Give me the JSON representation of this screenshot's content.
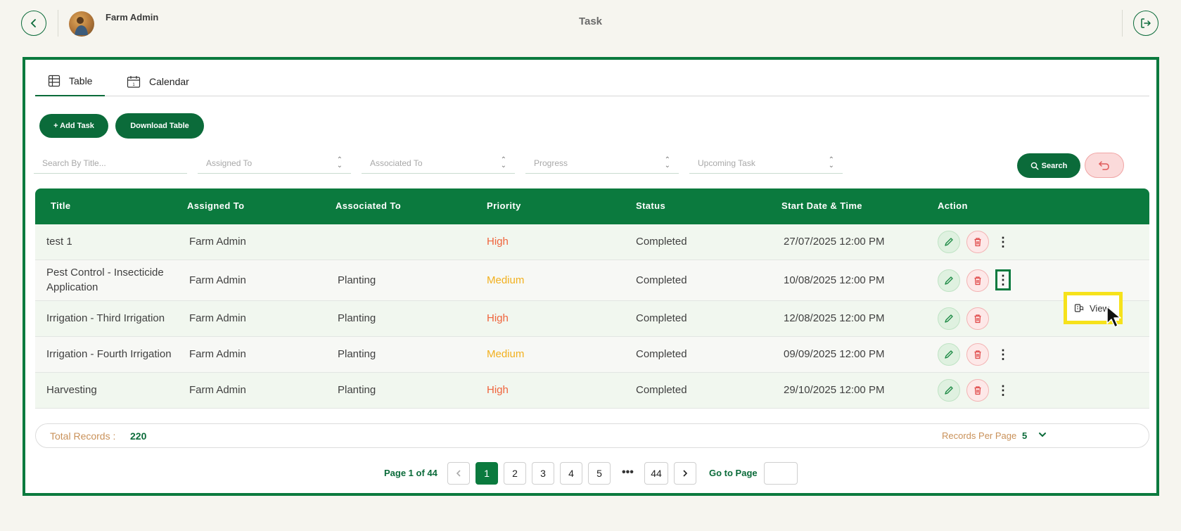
{
  "header": {
    "user_name": "Farm Admin",
    "title": "Task"
  },
  "tabs": [
    {
      "label": "Table",
      "icon": "table-icon",
      "active": true
    },
    {
      "label": "Calendar",
      "icon": "calendar-icon",
      "active": false
    }
  ],
  "toolbar": {
    "add_label": "+ Add Task",
    "download_label": "Download Table",
    "search_label": "Search"
  },
  "filters": {
    "title_placeholder": "Search By Title...",
    "assigned": "Assigned To",
    "associated": "Associated To",
    "progress": "Progress",
    "upcoming": "Upcoming Task"
  },
  "table": {
    "headers": [
      "Title",
      "Assigned To",
      "Associated To",
      "Priority",
      "Status",
      "Start Date & Time",
      "Action"
    ],
    "rows": [
      {
        "title": "test 1",
        "assigned": "Farm Admin",
        "associated": "",
        "priority": "High",
        "status": "Completed",
        "start": "27/07/2025 12:00 PM"
      },
      {
        "title": "Pest Control - Insecticide Application",
        "assigned": "Farm Admin",
        "associated": "Planting",
        "priority": "Medium",
        "status": "Completed",
        "start": "10/08/2025 12:00 PM"
      },
      {
        "title": "Irrigation - Third Irrigation",
        "assigned": "Farm Admin",
        "associated": "Planting",
        "priority": "High",
        "status": "Completed",
        "start": "12/08/2025 12:00 PM"
      },
      {
        "title": "Irrigation - Fourth Irrigation",
        "assigned": "Farm Admin",
        "associated": "Planting",
        "priority": "Medium",
        "status": "Completed",
        "start": "09/09/2025 12:00 PM"
      },
      {
        "title": "Harvesting",
        "assigned": "Farm Admin",
        "associated": "Planting",
        "priority": "High",
        "status": "Completed",
        "start": "29/10/2025 12:00 PM"
      }
    ]
  },
  "row_menu": {
    "view_label": "View"
  },
  "footer": {
    "total_label": "Total Records :",
    "total_value": "220",
    "per_page_label": "Records Per Page",
    "per_page_value": "5"
  },
  "pagination": {
    "page_info": "Page 1 of 44",
    "pages": [
      "1",
      "2",
      "3",
      "4",
      "5"
    ],
    "ellipsis": "•••",
    "last": "44",
    "goto_label": "Go to Page"
  },
  "colors": {
    "brand_green": "#0b7a3e",
    "high": "#f0643c",
    "medium": "#f2b01e",
    "highlight": "#f6e21b"
  }
}
